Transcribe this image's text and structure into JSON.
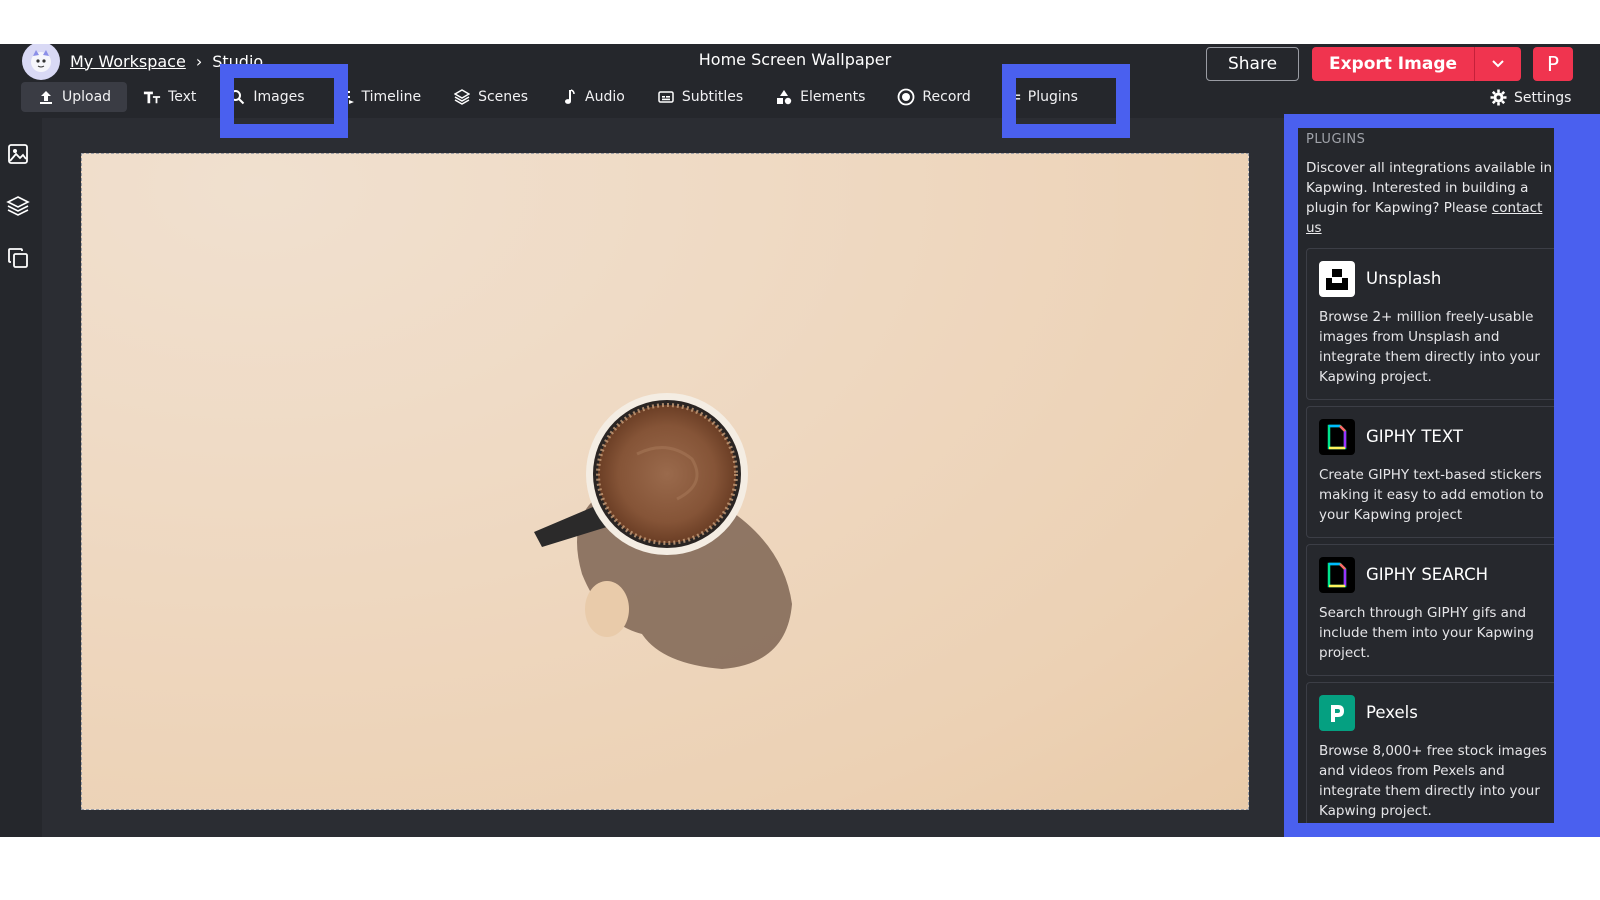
{
  "header": {
    "workspace_label": "My Workspace",
    "separator": "›",
    "section_label": "Studio",
    "project_title": "Home Screen Wallpaper",
    "share_label": "Share",
    "export_label": "Export Image",
    "profile_initial": "P"
  },
  "toolbar": {
    "items": [
      {
        "label": "Upload",
        "icon": "upload-icon"
      },
      {
        "label": "Text",
        "icon": "text-icon"
      },
      {
        "label": "Images",
        "icon": "search-icon"
      },
      {
        "label": "Timeline",
        "icon": "timeline-icon"
      },
      {
        "label": "Scenes",
        "icon": "layers-icon"
      },
      {
        "label": "Audio",
        "icon": "music-note-icon"
      },
      {
        "label": "Subtitles",
        "icon": "subtitles-icon"
      },
      {
        "label": "Elements",
        "icon": "shapes-icon"
      },
      {
        "label": "Record",
        "icon": "record-icon"
      },
      {
        "label": "Plugins",
        "icon": "plug-icon"
      }
    ],
    "settings_label": "Settings"
  },
  "sidebar": {
    "icons": [
      "image-icon",
      "layers-icon",
      "copy-icon"
    ]
  },
  "plugins_panel": {
    "heading": "PLUGINS",
    "description": "Discover all integrations available in Kapwing. Interested in building a plugin for Kapwing? Please",
    "contact_link": "contact us",
    "cards": [
      {
        "name": "Unsplash",
        "icon": "unsplash-logo",
        "description": "Browse 2+ million freely-usable images from Unsplash and integrate them directly into your Kapwing project."
      },
      {
        "name": "GIPHY TEXT",
        "icon": "giphy-logo",
        "description": "Create GIPHY text-based stickers making it easy to add emotion to your Kapwing project"
      },
      {
        "name": "GIPHY SEARCH",
        "icon": "giphy-logo",
        "description": "Search through GIPHY gifs and include them into your Kapwing project."
      },
      {
        "name": "Pexels",
        "icon": "pexels-logo",
        "description": "Browse 8,000+ free stock images and videos from Pexels and integrate them directly into your Kapwing project."
      }
    ]
  },
  "colors": {
    "accent_red": "#f0344f",
    "highlight_blue": "#4a60ef",
    "pexels_green": "#05a081"
  }
}
